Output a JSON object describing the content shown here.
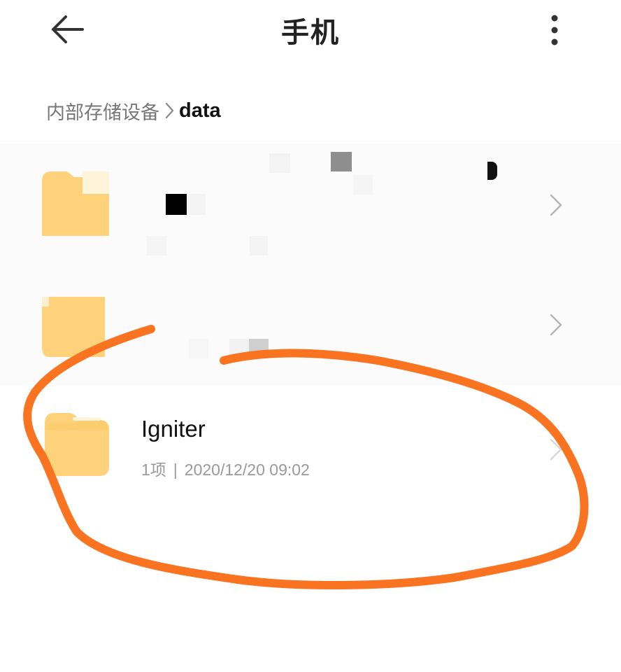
{
  "header": {
    "title": "手机"
  },
  "breadcrumb": {
    "root": "内部存储设备",
    "current": "data"
  },
  "items": [
    {
      "name": "",
      "meta_count": "",
      "meta_date": ""
    },
    {
      "name": "",
      "meta_count": "",
      "meta_date": ""
    },
    {
      "name": "Igniter",
      "meta_count": "1项",
      "meta_separator": "|",
      "meta_date": "2020/12/20 09:02"
    }
  ],
  "icons": {
    "back": "arrow-left-icon",
    "more": "more-vertical-icon",
    "folder": "folder-icon",
    "chevron": "chevron-right-icon"
  },
  "colors": {
    "folder": "#fdd27a",
    "folder_tab": "#f9c85f",
    "annotation": "#f97321",
    "meta_text": "#9a9a9a",
    "breadcrumb_root": "#777777"
  }
}
